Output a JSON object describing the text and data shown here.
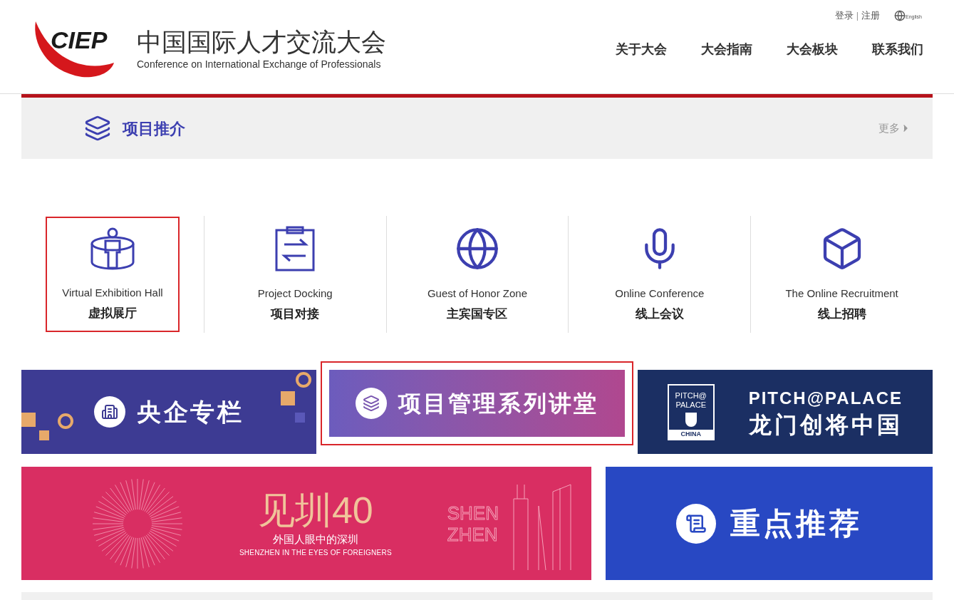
{
  "header": {
    "logo": "CIEP",
    "title_cn": "中国国际人才交流大会",
    "title_en": "Conference on International Exchange of Professionals",
    "top_links": [
      "登录",
      "注册"
    ],
    "separator": "|",
    "language": "English",
    "nav": [
      "关于大会",
      "大会指南",
      "大会板块",
      "联系我们"
    ]
  },
  "section": {
    "title": "项目推介",
    "more": "更多"
  },
  "quick_links": [
    {
      "kind": "hall",
      "en": "Virtual Exhibition Hall",
      "cn": "虚拟展厅",
      "selected": true
    },
    {
      "kind": "docking",
      "en": "Project Docking",
      "cn": "项目对接",
      "selected": false
    },
    {
      "kind": "globe",
      "en": "Guest of Honor Zone",
      "cn": "主宾国专区",
      "selected": false
    },
    {
      "kind": "mic",
      "en": "Online Conference",
      "cn": "线上会议",
      "selected": false
    },
    {
      "kind": "cube",
      "en": "The Online Recruitment",
      "cn": "线上招聘",
      "selected": false
    }
  ],
  "banners": [
    {
      "kind": "soe",
      "title": "央企专栏",
      "selected": false
    },
    {
      "kind": "lecture",
      "title": "项目管理系列讲堂",
      "selected": true
    },
    {
      "kind": "pitch",
      "title": "PITCH@PALACE",
      "subtitle": "龙门创将中国",
      "badge": [
        "PITCH@",
        "PALACE",
        "CHINA"
      ],
      "selected": false
    },
    {
      "kind": "shenzhen",
      "title": "见圳40",
      "subtitle": "外国人眼中的深圳",
      "caption": "SHENZHEN IN THE EYES OF FOREIGNERS",
      "side": [
        "SHEN",
        "ZHEN"
      ],
      "selected": false
    },
    {
      "kind": "featured",
      "title": "重点推荐",
      "selected": false
    }
  ]
}
